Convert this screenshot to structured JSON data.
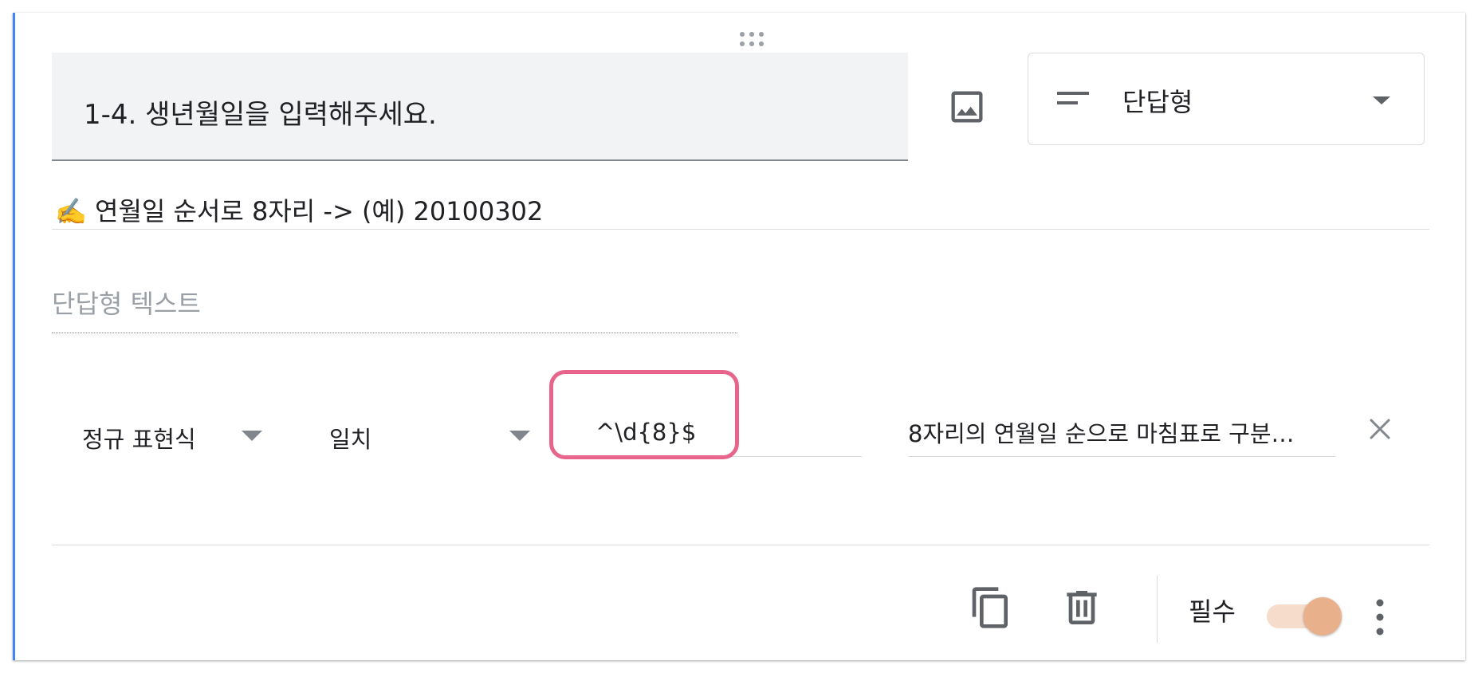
{
  "question": {
    "title": "1-4. 생년월일을 입력해주세요.",
    "description": "✍️ 연월일 순서로 8자리 -> (예) 20100302",
    "type_label": "단답형",
    "answer_placeholder": "단답형 텍스트"
  },
  "validation": {
    "type": "정규 표현식",
    "condition": "일치",
    "pattern": "^\\d{8}$",
    "error_text": "8자리의 연월일 순으로 마침표로 구분…"
  },
  "footer": {
    "required_label": "필수",
    "required_on": true
  },
  "icons": {
    "drag": "drag-handle-icon",
    "image": "image-icon",
    "short_answer": "short-text-icon",
    "dropdown": "arrow-drop-down-icon",
    "close": "close-icon",
    "copy": "copy-icon",
    "delete": "delete-icon",
    "more": "more-vert-icon"
  },
  "colors": {
    "accent_border": "#4285f4",
    "highlight": "#e8648a",
    "toggle_thumb": "#e9b08c",
    "toggle_track": "#f6dccb"
  }
}
